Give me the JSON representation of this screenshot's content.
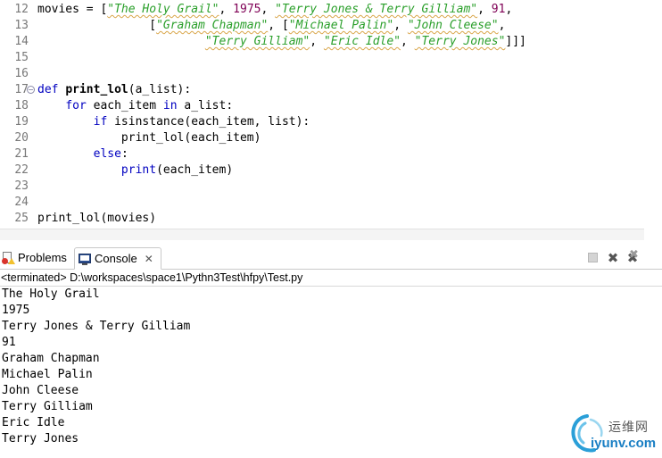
{
  "editor": {
    "lines": [
      {
        "num": "12",
        "tokens": [
          {
            "t": "movies = [",
            "c": ""
          },
          {
            "t": "\"The Holy Grail\"",
            "c": "str"
          },
          {
            "t": ", ",
            "c": ""
          },
          {
            "t": "1975",
            "c": "num"
          },
          {
            "t": ", ",
            "c": ""
          },
          {
            "t": "\"Terry Jones & Terry Gilliam\"",
            "c": "str"
          },
          {
            "t": ", ",
            "c": ""
          },
          {
            "t": "91",
            "c": "num"
          },
          {
            "t": ",",
            "c": ""
          }
        ]
      },
      {
        "num": "13",
        "tokens": [
          {
            "t": "                [",
            "c": ""
          },
          {
            "t": "\"Graham Chapman\"",
            "c": "str"
          },
          {
            "t": ", [",
            "c": ""
          },
          {
            "t": "\"Michael Palin\"",
            "c": "str"
          },
          {
            "t": ", ",
            "c": ""
          },
          {
            "t": "\"John Cleese\"",
            "c": "str"
          },
          {
            "t": ",",
            "c": ""
          }
        ]
      },
      {
        "num": "14",
        "tokens": [
          {
            "t": "                        ",
            "c": ""
          },
          {
            "t": "\"Terry Gilliam\"",
            "c": "str"
          },
          {
            "t": ", ",
            "c": ""
          },
          {
            "t": "\"Eric Idle\"",
            "c": "str"
          },
          {
            "t": ", ",
            "c": ""
          },
          {
            "t": "\"Terry Jones\"",
            "c": "str"
          },
          {
            "t": "]]]",
            "c": ""
          }
        ]
      },
      {
        "num": "15",
        "tokens": []
      },
      {
        "num": "16",
        "tokens": []
      },
      {
        "num": "17",
        "fold": "−",
        "tokens": [
          {
            "t": "def",
            "c": "kw"
          },
          {
            "t": " ",
            "c": ""
          },
          {
            "t": "print_lol",
            "c": "fn"
          },
          {
            "t": "(a_list):",
            "c": ""
          }
        ]
      },
      {
        "num": "18",
        "tokens": [
          {
            "t": "    ",
            "c": ""
          },
          {
            "t": "for",
            "c": "kw"
          },
          {
            "t": " each_item ",
            "c": ""
          },
          {
            "t": "in",
            "c": "kw"
          },
          {
            "t": " a_list:",
            "c": ""
          }
        ]
      },
      {
        "num": "19",
        "tokens": [
          {
            "t": "        ",
            "c": ""
          },
          {
            "t": "if",
            "c": "kw"
          },
          {
            "t": " isinstance(each_item, list):",
            "c": ""
          }
        ]
      },
      {
        "num": "20",
        "tokens": [
          {
            "t": "            print_lol(each_item)",
            "c": ""
          }
        ]
      },
      {
        "num": "21",
        "tokens": [
          {
            "t": "        ",
            "c": ""
          },
          {
            "t": "else",
            "c": "kw"
          },
          {
            "t": ":",
            "c": ""
          }
        ]
      },
      {
        "num": "22",
        "tokens": [
          {
            "t": "            ",
            "c": ""
          },
          {
            "t": "print",
            "c": "bi"
          },
          {
            "t": "(each_item)",
            "c": ""
          }
        ]
      },
      {
        "num": "23",
        "tokens": []
      },
      {
        "num": "24",
        "tokens": []
      },
      {
        "num": "25",
        "tokens": [
          {
            "t": "print_lol(movies)",
            "c": ""
          }
        ]
      }
    ]
  },
  "tabs": {
    "problems_label": "Problems",
    "console_label": "Console",
    "console_close": "✕"
  },
  "console": {
    "status": "<terminated> D:\\workspaces\\space1\\Pythn3Test\\hfpy\\Test.py",
    "output": [
      "The Holy Grail",
      "1975",
      "Terry Jones & Terry Gilliam",
      "91",
      "Graham Chapman",
      "Michael Palin",
      "John Cleese",
      "Terry Gilliam",
      "Eric Idle",
      "Terry Jones"
    ]
  },
  "toolbar": {
    "remove_glyph": "✖",
    "remove_all_glyph": "✖"
  },
  "watermark": {
    "cn": "运维网",
    "en": "iyunv.com"
  },
  "colors": {
    "string": "#2a9f2a",
    "number": "#7f0055",
    "keyword": "#0000c0",
    "watermark_blue": "#1a7fc4"
  }
}
